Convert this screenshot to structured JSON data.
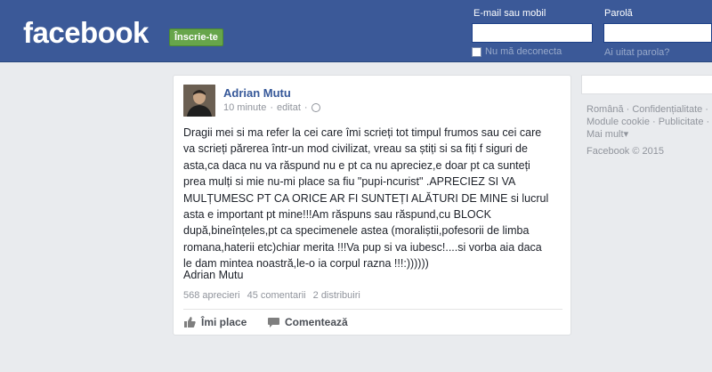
{
  "header": {
    "logo": "facebook",
    "signup_label": "Înscrie-te",
    "email_label": "E-mail sau mobil",
    "password_label": "Parolă",
    "remember_label": "Nu mă deconecta",
    "forgot_label": "Ai uitat parola?"
  },
  "post": {
    "author": "Adrian Mutu",
    "time": "10 minute",
    "edited": "editat",
    "body": "Dragii mei si ma refer la cei care îmi scrieți tot timpul frumos sau cei care\nva scrieți părerea într-un mod civilizat, vreau sa știți si sa fiți f siguri de\nasta,ca daca nu va răspund nu e pt ca nu apreciez,e doar pt ca sunteți\nprea mulți si mie nu-mi place sa fiu \"pupi-ncurist\" .APRECIEZ SI VA\nMULȚUMESC PT CA ORICE AR FI SUNTEȚI ALĂTURI DE MINE si lucrul\nasta e important pt mine!!!Am răspuns sau răspund,cu BLOCK\ndupă,bineînțeles,pt ca specimenele astea (moraliștii,pofesorii de limba\nromana,haterii etc)chiar merita !!!Va pup si va iubesc!....si vorba aia daca\nle dam mintea noastră,le-o ia corpul razna !!!:))))))",
    "signature": "Adrian Mutu",
    "likes": "568 aprecieri",
    "comments": "45 comentarii",
    "shares": "2 distribuiri",
    "like_action": "Îmi place",
    "comment_action": "Comentează"
  },
  "sidebar": {
    "link_romana": "Română",
    "link_privacy": "Confidențialitate",
    "link_cookies": "Module cookie",
    "link_ads": "Publicitate",
    "link_more": "Mai mult",
    "copyright": "Facebook © 2015"
  }
}
